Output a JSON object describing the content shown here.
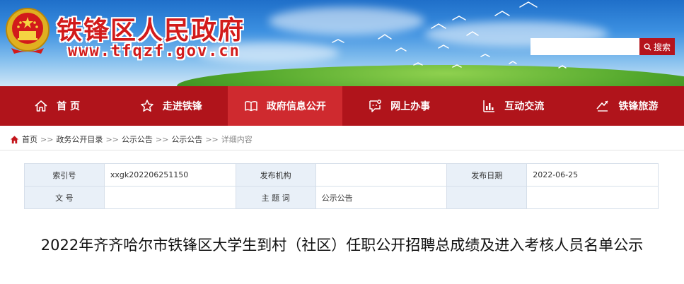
{
  "header": {
    "site_name": "铁锋区人民政府",
    "site_url": "www.tfqzf.gov.cn",
    "search": {
      "placeholder": "",
      "button_label": "搜索"
    }
  },
  "nav": {
    "items": [
      {
        "label": "首 页",
        "icon": "home-icon"
      },
      {
        "label": "走进铁锋",
        "icon": "star-icon"
      },
      {
        "label": "政府信息公开",
        "icon": "book-icon",
        "active": true
      },
      {
        "label": "网上办事",
        "icon": "chat-icon"
      },
      {
        "label": "互动交流",
        "icon": "bar-chart-icon"
      },
      {
        "label": "铁锋旅游",
        "icon": "travel-icon"
      }
    ]
  },
  "breadcrumb": {
    "items": [
      "首页",
      "政务公开目录",
      "公示公告",
      "公示公告",
      "详细内容"
    ],
    "separator": ">>"
  },
  "meta": {
    "index_label": "索引号",
    "index_value": "xxgk202206251150",
    "publisher_label": "发布机构",
    "publisher_value": "",
    "date_label": "发布日期",
    "date_value": "2022-06-25",
    "docno_label": "文 号",
    "docno_value": "",
    "subject_label": "主 题 词",
    "subject_value": "公示公告"
  },
  "article": {
    "title": "2022年齐齐哈尔市铁锋区大学生到村（社区）任职公开招聘总成绩及进入考核人员名单公示"
  },
  "colors": {
    "brand_red": "#b0141b",
    "active_red": "#cf2a2f",
    "title_red": "#d21b1b"
  }
}
